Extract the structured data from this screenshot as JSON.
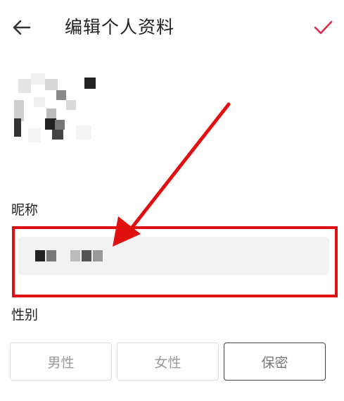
{
  "header": {
    "title": "编辑个人资料",
    "back_icon": "arrow-left-icon",
    "confirm_icon": "checkmark-icon",
    "accent_color": "#e02a4a"
  },
  "profile": {
    "nickname_label": "昵称",
    "gender_label": "性别",
    "gender_options": [
      "男性",
      "女性",
      "保密"
    ],
    "selected_gender": "保密"
  },
  "annotation": {
    "color": "#e01010",
    "arrow_icon": "red-arrow-annotation",
    "box": "red-highlight-box"
  }
}
